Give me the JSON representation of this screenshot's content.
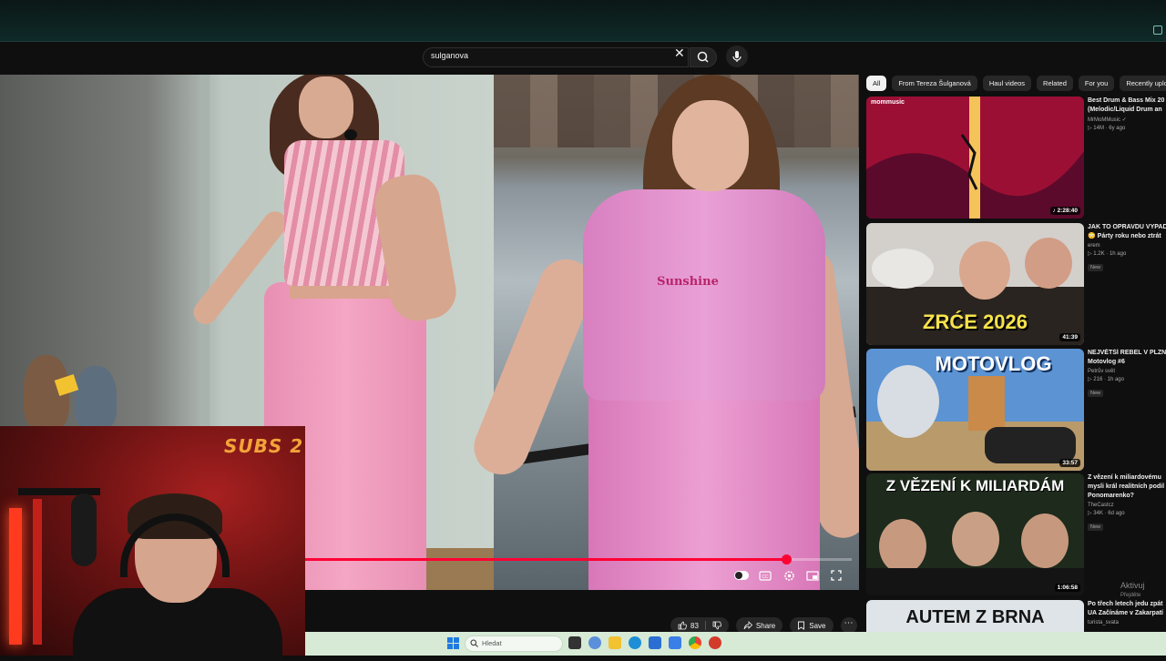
{
  "search": {
    "query": "sulganova"
  },
  "video": {
    "shirt_text": "Sunshine",
    "progress_percent": 88
  },
  "overlay": {
    "webcam_label": "SUBS 2"
  },
  "actions": {
    "like_count": "83",
    "share_label": "Share",
    "save_label": "Save"
  },
  "chips": [
    "All",
    "From Tereza Šulganová",
    "Haul videos",
    "Related",
    "For you",
    "Recently uploaded"
  ],
  "recommendations": [
    {
      "title1": "Best Drum & Bass Mix 20",
      "title2": "(Melodic/Liquid Drum an",
      "channel": "MrMoMMusic ✓",
      "stats": "▷ 14M · 6y ago",
      "badge": "",
      "duration": "♪ 2:28:40",
      "thumb_text": "",
      "thumb_brand": "mommusic",
      "thumb_color1": "#b5123e",
      "thumb_color2": "#3b0a2a"
    },
    {
      "title1": "JAK TO OPRAVDU VYPAD",
      "title2": "😳 Párty roku nebo ztrát",
      "channel": "erem",
      "stats": "▷ 1.2K · 1h ago",
      "badge": "New",
      "duration": "41:39",
      "thumb_text": "ZRĆE 2026",
      "thumb_brand": "",
      "thumb_color1": "#c9c6c2",
      "thumb_color2": "#2a2420"
    },
    {
      "title1": "NEJVĚTŠÍ REBEL V PLZN",
      "title2": "Motovlog #6",
      "channel": "Petrův svět",
      "stats": "▷ 216 · 1h ago",
      "badge": "New",
      "duration": "33:57",
      "thumb_text": "MOTOVLOG",
      "thumb_brand": "",
      "thumb_color1": "#4f86c9",
      "thumb_color2": "#c79a57"
    },
    {
      "title1": "Z vězení k miliardovému",
      "title2": "mysli král realitních podil",
      "title3": "Ponomarenko?",
      "channel": "TheCastcz",
      "stats": "▷ 34K · 6d ago",
      "badge": "New",
      "duration": "1:06:58",
      "thumb_text": "Z VĚZENÍ K MILIARDÁM",
      "thumb_brand": "",
      "thumb_color1": "#2b3a2a",
      "thumb_color2": "#0e150d"
    },
    {
      "title1": "Po třech letech jedu zpát",
      "title2": "UA Začínáme v Zakarpatí",
      "channel": "turista_svata",
      "stats": "",
      "badge": "",
      "duration": "",
      "thumb_text": "AUTEM Z BRNA",
      "thumb_brand": "",
      "thumb_color1": "#dfe4e8",
      "thumb_color2": "#9aa4ad"
    }
  ],
  "watermark": {
    "line1": "Aktivuj",
    "line2": "Přejděte"
  },
  "taskbar": {
    "search_placeholder": "Hledat"
  },
  "colors": {
    "accent": "#ff0033",
    "chip_active": "#f1f1f1",
    "taskbar": "#d6ead6"
  }
}
